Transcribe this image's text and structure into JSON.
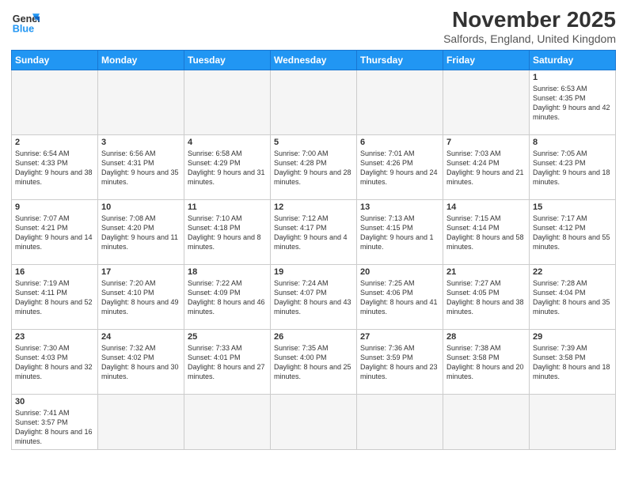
{
  "header": {
    "logo_general": "General",
    "logo_blue": "Blue",
    "title": "November 2025",
    "subtitle": "Salfords, England, United Kingdom"
  },
  "weekdays": [
    "Sunday",
    "Monday",
    "Tuesday",
    "Wednesday",
    "Thursday",
    "Friday",
    "Saturday"
  ],
  "weeks": [
    [
      {
        "day": "",
        "info": "",
        "empty": true
      },
      {
        "day": "",
        "info": "",
        "empty": true
      },
      {
        "day": "",
        "info": "",
        "empty": true
      },
      {
        "day": "",
        "info": "",
        "empty": true
      },
      {
        "day": "",
        "info": "",
        "empty": true
      },
      {
        "day": "",
        "info": "",
        "empty": true
      },
      {
        "day": "1",
        "info": "Sunrise: 6:53 AM\nSunset: 4:35 PM\nDaylight: 9 hours and 42 minutes."
      }
    ],
    [
      {
        "day": "2",
        "info": "Sunrise: 6:54 AM\nSunset: 4:33 PM\nDaylight: 9 hours and 38 minutes."
      },
      {
        "day": "3",
        "info": "Sunrise: 6:56 AM\nSunset: 4:31 PM\nDaylight: 9 hours and 35 minutes."
      },
      {
        "day": "4",
        "info": "Sunrise: 6:58 AM\nSunset: 4:29 PM\nDaylight: 9 hours and 31 minutes."
      },
      {
        "day": "5",
        "info": "Sunrise: 7:00 AM\nSunset: 4:28 PM\nDaylight: 9 hours and 28 minutes."
      },
      {
        "day": "6",
        "info": "Sunrise: 7:01 AM\nSunset: 4:26 PM\nDaylight: 9 hours and 24 minutes."
      },
      {
        "day": "7",
        "info": "Sunrise: 7:03 AM\nSunset: 4:24 PM\nDaylight: 9 hours and 21 minutes."
      },
      {
        "day": "8",
        "info": "Sunrise: 7:05 AM\nSunset: 4:23 PM\nDaylight: 9 hours and 18 minutes."
      }
    ],
    [
      {
        "day": "9",
        "info": "Sunrise: 7:07 AM\nSunset: 4:21 PM\nDaylight: 9 hours and 14 minutes."
      },
      {
        "day": "10",
        "info": "Sunrise: 7:08 AM\nSunset: 4:20 PM\nDaylight: 9 hours and 11 minutes."
      },
      {
        "day": "11",
        "info": "Sunrise: 7:10 AM\nSunset: 4:18 PM\nDaylight: 9 hours and 8 minutes."
      },
      {
        "day": "12",
        "info": "Sunrise: 7:12 AM\nSunset: 4:17 PM\nDaylight: 9 hours and 4 minutes."
      },
      {
        "day": "13",
        "info": "Sunrise: 7:13 AM\nSunset: 4:15 PM\nDaylight: 9 hours and 1 minute."
      },
      {
        "day": "14",
        "info": "Sunrise: 7:15 AM\nSunset: 4:14 PM\nDaylight: 8 hours and 58 minutes."
      },
      {
        "day": "15",
        "info": "Sunrise: 7:17 AM\nSunset: 4:12 PM\nDaylight: 8 hours and 55 minutes."
      }
    ],
    [
      {
        "day": "16",
        "info": "Sunrise: 7:19 AM\nSunset: 4:11 PM\nDaylight: 8 hours and 52 minutes."
      },
      {
        "day": "17",
        "info": "Sunrise: 7:20 AM\nSunset: 4:10 PM\nDaylight: 8 hours and 49 minutes."
      },
      {
        "day": "18",
        "info": "Sunrise: 7:22 AM\nSunset: 4:09 PM\nDaylight: 8 hours and 46 minutes."
      },
      {
        "day": "19",
        "info": "Sunrise: 7:24 AM\nSunset: 4:07 PM\nDaylight: 8 hours and 43 minutes."
      },
      {
        "day": "20",
        "info": "Sunrise: 7:25 AM\nSunset: 4:06 PM\nDaylight: 8 hours and 41 minutes."
      },
      {
        "day": "21",
        "info": "Sunrise: 7:27 AM\nSunset: 4:05 PM\nDaylight: 8 hours and 38 minutes."
      },
      {
        "day": "22",
        "info": "Sunrise: 7:28 AM\nSunset: 4:04 PM\nDaylight: 8 hours and 35 minutes."
      }
    ],
    [
      {
        "day": "23",
        "info": "Sunrise: 7:30 AM\nSunset: 4:03 PM\nDaylight: 8 hours and 32 minutes."
      },
      {
        "day": "24",
        "info": "Sunrise: 7:32 AM\nSunset: 4:02 PM\nDaylight: 8 hours and 30 minutes."
      },
      {
        "day": "25",
        "info": "Sunrise: 7:33 AM\nSunset: 4:01 PM\nDaylight: 8 hours and 27 minutes."
      },
      {
        "day": "26",
        "info": "Sunrise: 7:35 AM\nSunset: 4:00 PM\nDaylight: 8 hours and 25 minutes."
      },
      {
        "day": "27",
        "info": "Sunrise: 7:36 AM\nSunset: 3:59 PM\nDaylight: 8 hours and 23 minutes."
      },
      {
        "day": "28",
        "info": "Sunrise: 7:38 AM\nSunset: 3:58 PM\nDaylight: 8 hours and 20 minutes."
      },
      {
        "day": "29",
        "info": "Sunrise: 7:39 AM\nSunset: 3:58 PM\nDaylight: 8 hours and 18 minutes."
      }
    ],
    [
      {
        "day": "30",
        "info": "Sunrise: 7:41 AM\nSunset: 3:57 PM\nDaylight: 8 hours and 16 minutes.",
        "last": true
      },
      {
        "day": "",
        "info": "",
        "empty": true,
        "last": true
      },
      {
        "day": "",
        "info": "",
        "empty": true,
        "last": true
      },
      {
        "day": "",
        "info": "",
        "empty": true,
        "last": true
      },
      {
        "day": "",
        "info": "",
        "empty": true,
        "last": true
      },
      {
        "day": "",
        "info": "",
        "empty": true,
        "last": true
      },
      {
        "day": "",
        "info": "",
        "empty": true,
        "last": true
      }
    ]
  ]
}
